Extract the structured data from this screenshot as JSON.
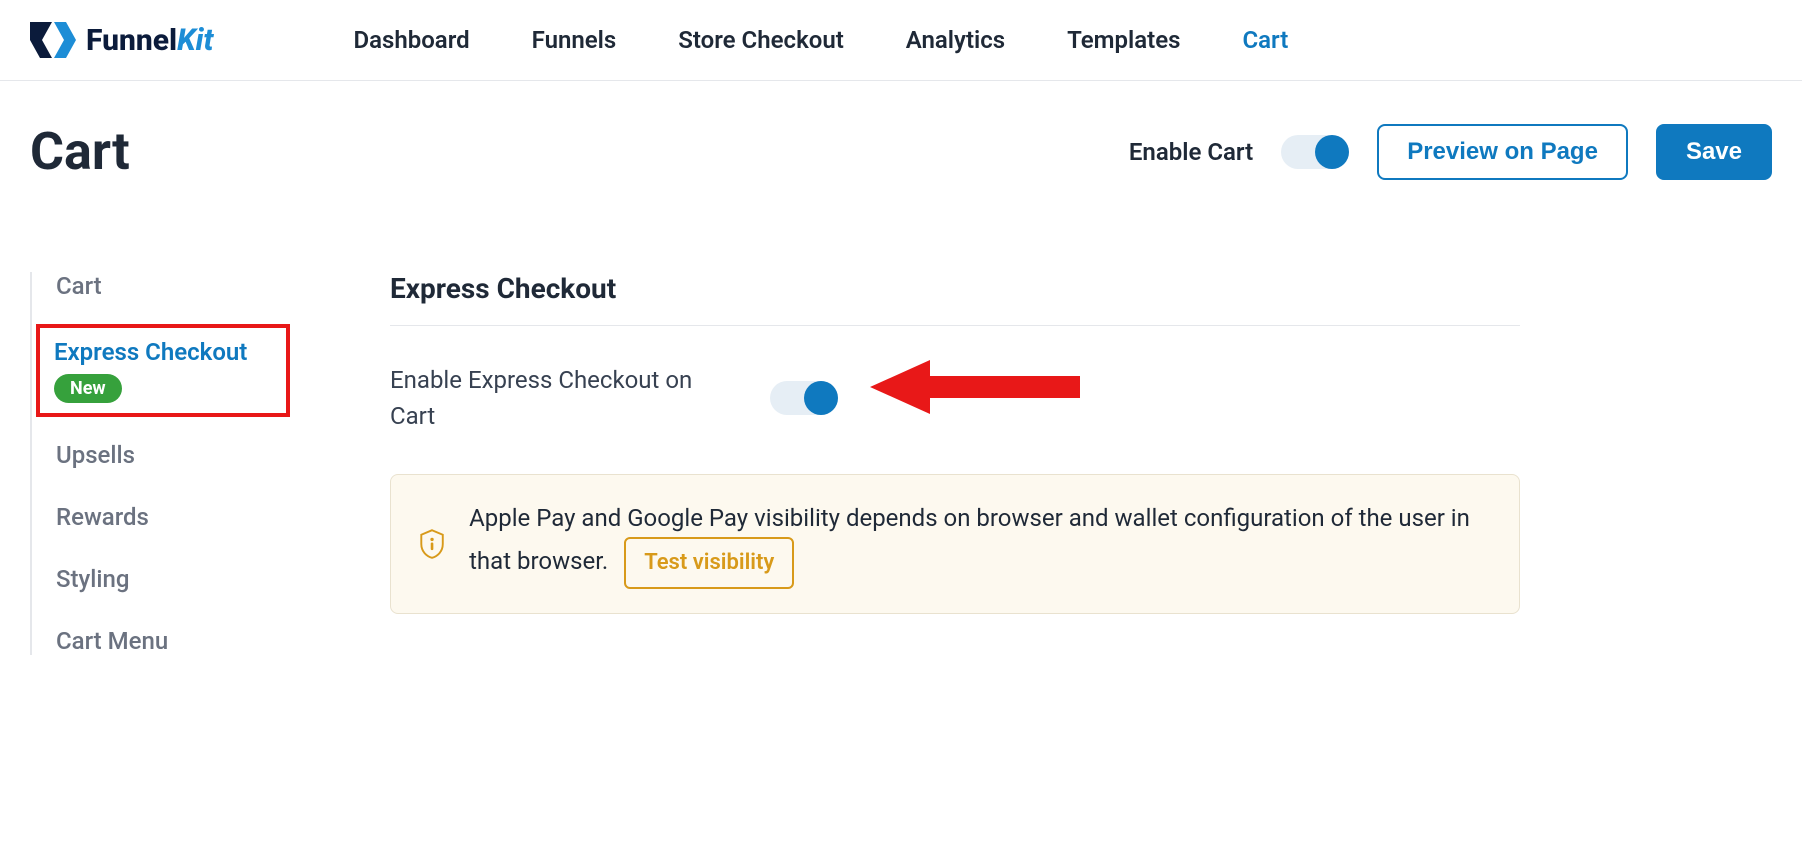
{
  "brand": {
    "name1": "Funnel",
    "name2": "Kit"
  },
  "nav": {
    "items": [
      {
        "label": "Dashboard",
        "active": false
      },
      {
        "label": "Funnels",
        "active": false
      },
      {
        "label": "Store Checkout",
        "active": false
      },
      {
        "label": "Analytics",
        "active": false
      },
      {
        "label": "Templates",
        "active": false
      },
      {
        "label": "Cart",
        "active": true
      }
    ]
  },
  "header": {
    "title": "Cart",
    "enable_label": "Enable Cart",
    "preview_label": "Preview on Page",
    "save_label": "Save"
  },
  "sidebar": {
    "items": [
      {
        "label": "Cart"
      },
      {
        "label": "Express Checkout",
        "badge": "New",
        "active": true
      },
      {
        "label": "Upsells"
      },
      {
        "label": "Rewards"
      },
      {
        "label": "Styling"
      },
      {
        "label": "Cart Menu"
      }
    ]
  },
  "main": {
    "section_title": "Express Checkout",
    "enable_label": "Enable Express Checkout on Cart",
    "info_text": "Apple Pay and Google Pay visibility depends on browser and wallet configuration of the user in that browser.",
    "test_label": "Test visibility"
  },
  "colors": {
    "accent": "#0f79bf",
    "highlight": "#e81818",
    "badge": "#36a13c",
    "warn": "#d89a1a"
  }
}
